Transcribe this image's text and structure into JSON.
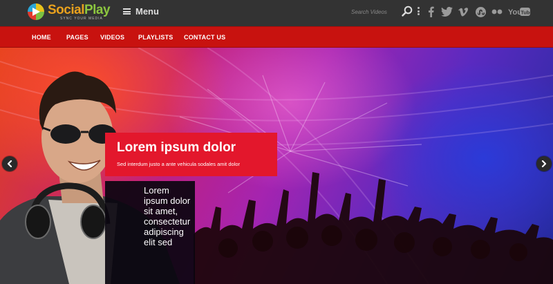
{
  "brand": {
    "name_part1": "Social",
    "name_part2": "Play",
    "tagline": "SYNC YOUR MEDIA"
  },
  "header": {
    "menu_label": "Menu",
    "search_placeholder": "Search Videos"
  },
  "social_links": [
    {
      "name": "facebook-icon"
    },
    {
      "name": "twitter-icon"
    },
    {
      "name": "vimeo-icon"
    },
    {
      "name": "stumbleupon-icon"
    },
    {
      "name": "flickr-icon"
    },
    {
      "name": "youtube-icon",
      "label_part1": "You",
      "label_part2": "Tube"
    }
  ],
  "nav": {
    "items": [
      {
        "label": "HOME"
      },
      {
        "label": "PAGES"
      },
      {
        "label": "VIDEOS"
      },
      {
        "label": "PLAYLISTS"
      },
      {
        "label": "CONTACT US"
      }
    ]
  },
  "hero": {
    "caption_title": "Lorem ipsum dolor",
    "caption_subtitle": "Sed interdum justo a ante vehicula sodales amit dolor",
    "panel_text": "Lorem ipsum dolor sit amet, consectetur adipiscing elit sed"
  },
  "colors": {
    "topbar": "#333333",
    "navbar": "#c8120f",
    "caption_bg": "#e3172c",
    "logo_orange": "#e9a11d",
    "logo_green": "#8cc63f"
  }
}
